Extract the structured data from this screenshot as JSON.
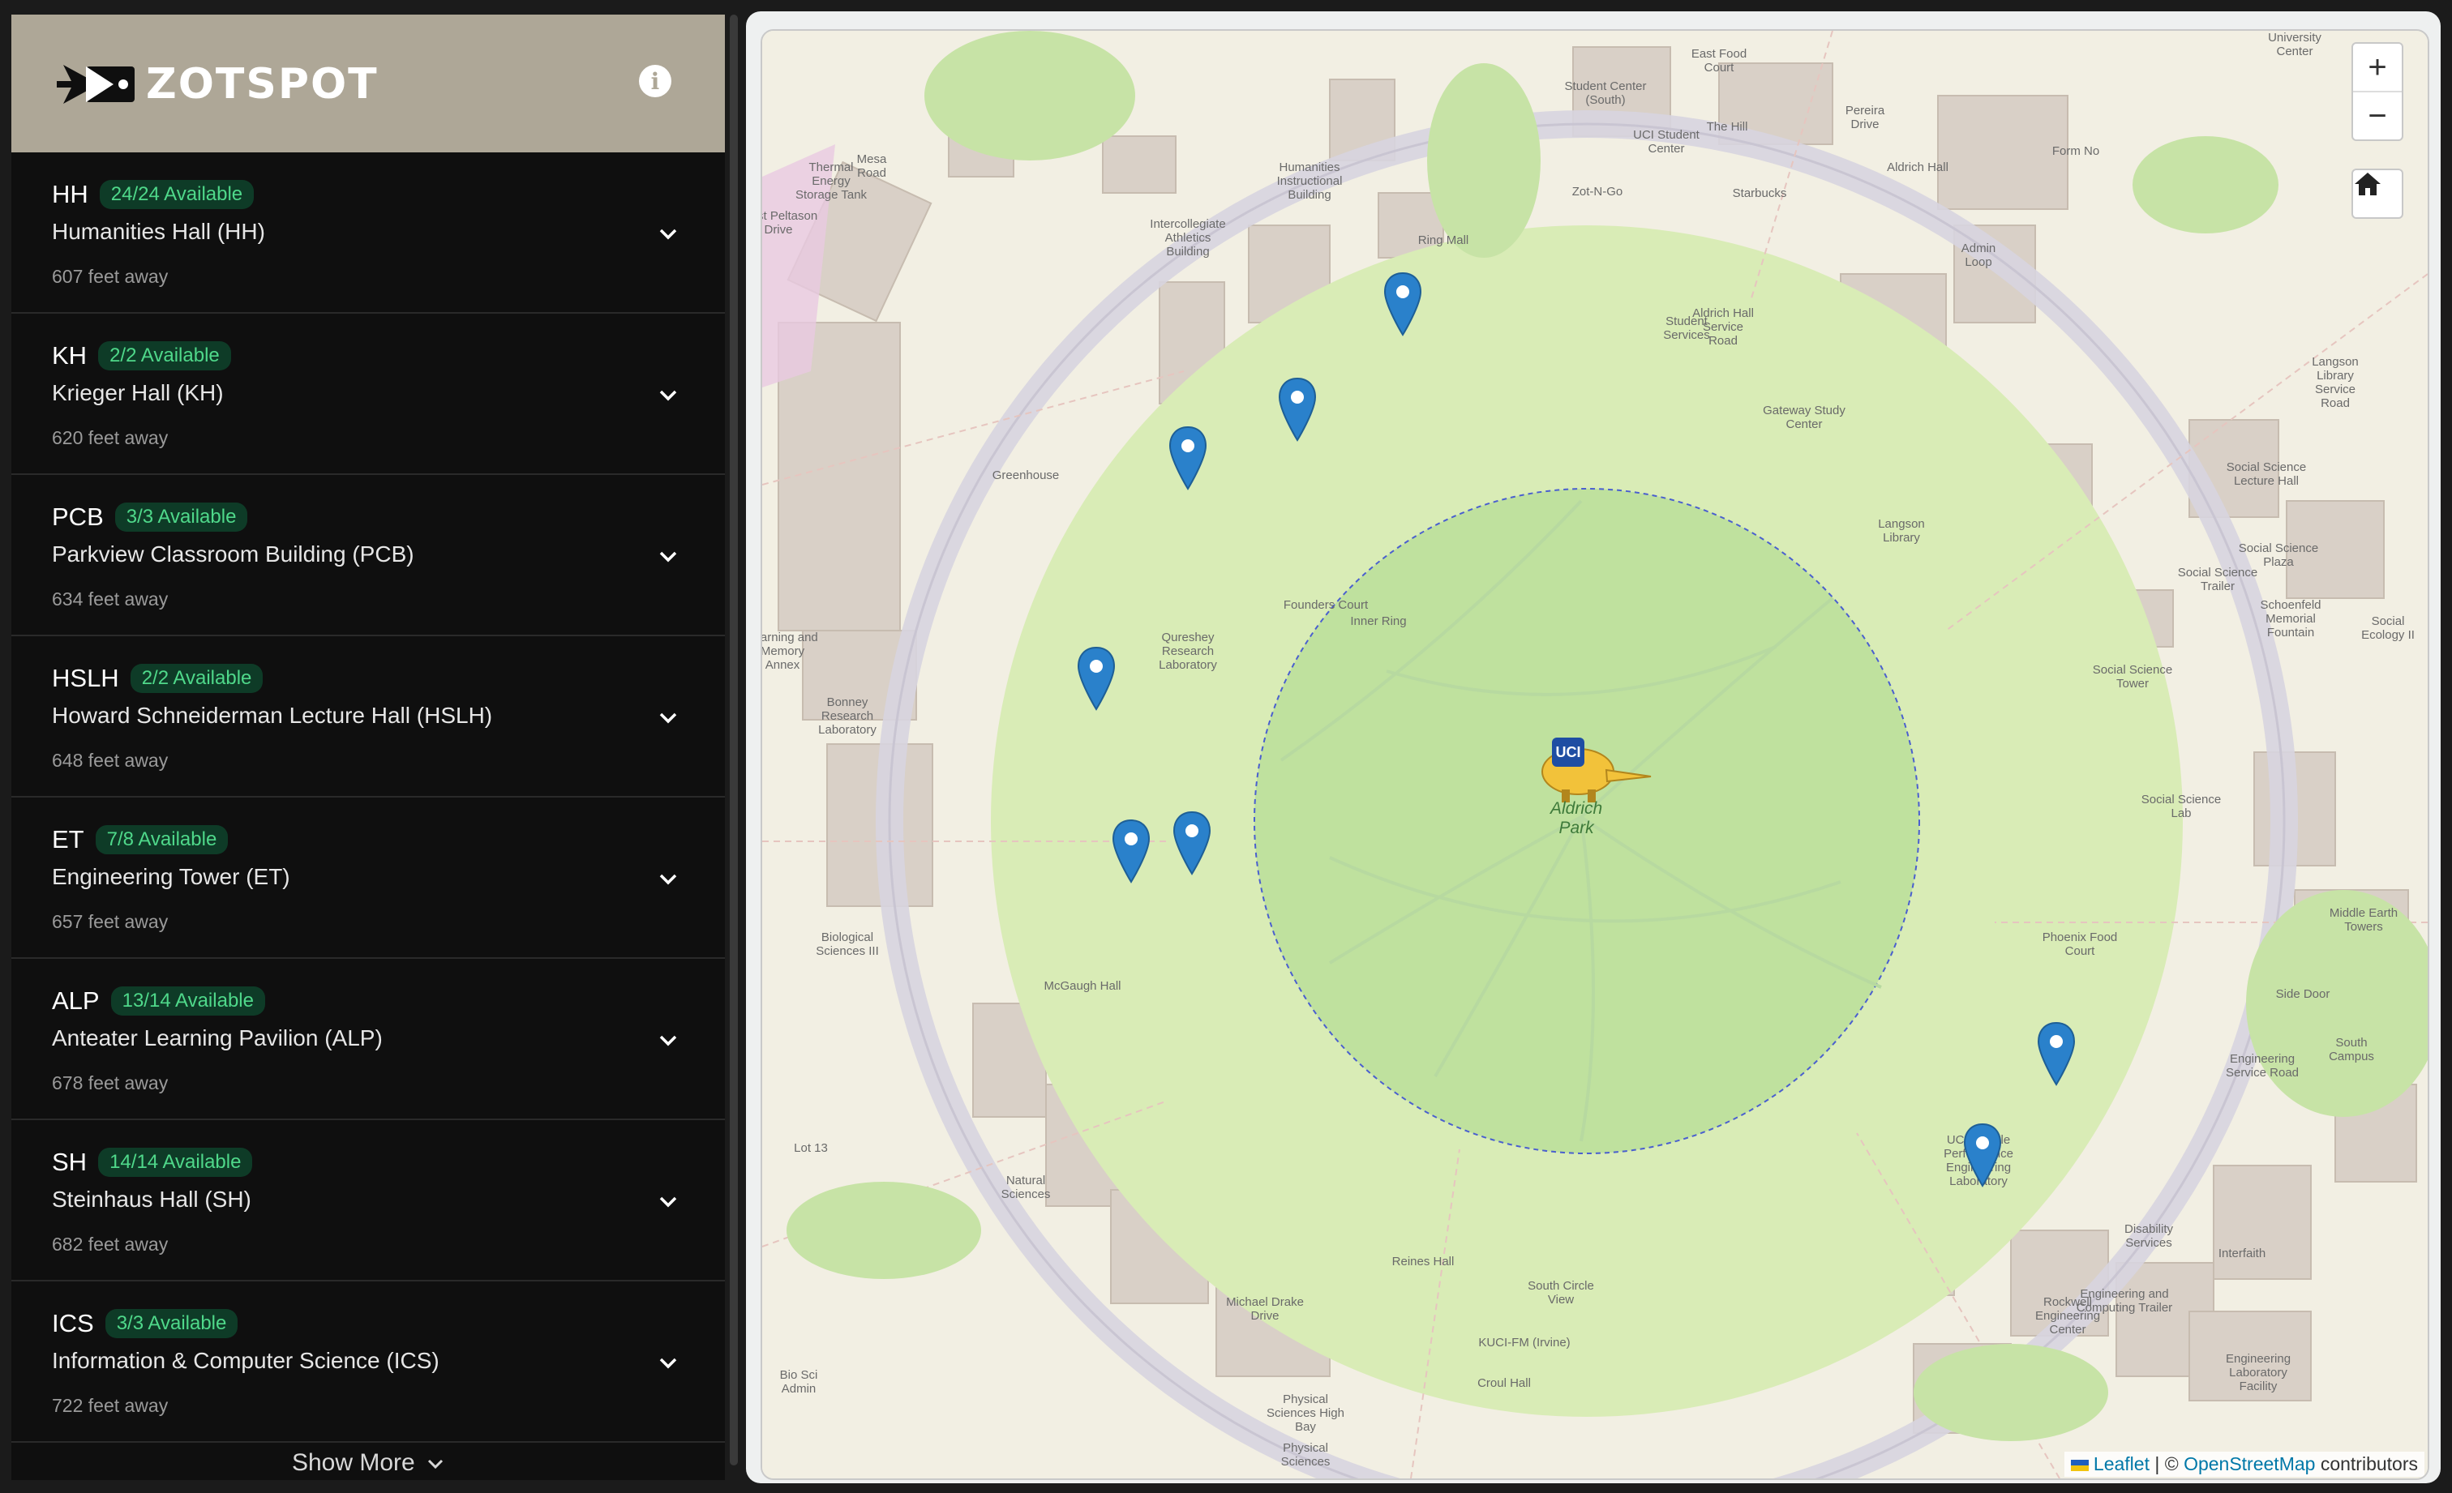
{
  "app": {
    "title": "ZOTSPOT"
  },
  "buildings": [
    {
      "code": "HH",
      "badge": "24/24 Available",
      "name": "Humanities Hall (HH)",
      "distance": "607 feet away"
    },
    {
      "code": "KH",
      "badge": "2/2 Available",
      "name": "Krieger Hall (KH)",
      "distance": "620 feet away"
    },
    {
      "code": "PCB",
      "badge": "3/3 Available",
      "name": "Parkview Classroom Building (PCB)",
      "distance": "634 feet away"
    },
    {
      "code": "HSLH",
      "badge": "2/2 Available",
      "name": "Howard Schneiderman Lecture Hall (HSLH)",
      "distance": "648 feet away"
    },
    {
      "code": "ET",
      "badge": "7/8 Available",
      "name": "Engineering Tower (ET)",
      "distance": "657 feet away"
    },
    {
      "code": "ALP",
      "badge": "13/14 Available",
      "name": "Anteater Learning Pavilion (ALP)",
      "distance": "678 feet away"
    },
    {
      "code": "SH",
      "badge": "14/14 Available",
      "name": "Steinhaus Hall (SH)",
      "distance": "682 feet away"
    },
    {
      "code": "ICS",
      "badge": "3/3 Available",
      "name": "Information & Computer Science (ICS)",
      "distance": "722 feet away"
    }
  ],
  "show_more": "Show More",
  "map": {
    "zoom_in": "+",
    "zoom_out": "−",
    "attribution": {
      "leaflet": "Leaflet",
      "sep": "| ©",
      "osm": "OpenStreetMap",
      "contributors": "contributors"
    },
    "park_label_1": "Aldrich",
    "park_label_2": "Park",
    "labels": [
      "Student Center (South)",
      "UCI Student Center",
      "Humanities Instructional Building",
      "Intercollegiate Athletics Building",
      "Thermal Energy Storage Tank",
      "Greenhouse",
      "Founders Court",
      "Qureshey Research Laboratory",
      "Bonney Research Laboratory",
      "Biological Sciences III",
      "McGaugh Hall",
      "Natural Sciences",
      "Reines Hall",
      "Croul Hall",
      "Physical Sciences High Bay",
      "Physical Sciences",
      "Langson Library",
      "Gateway Study Center",
      "Student Services",
      "Aldrich Hall",
      "Social Science Lecture Hall",
      "Social Science Plaza",
      "Social Science Tower",
      "Social Science Lab",
      "Social Ecology II",
      "Middle Earth Towers",
      "Phoenix Food Court",
      "Engineering Laboratory Facility",
      "Engineering and Computing Trailer",
      "Rockwell Engineering Center",
      "Disability Services",
      "Interfaith",
      "KUCI-FM (Irvine)",
      "Starbucks",
      "Zot-N-Go",
      "The Hill",
      "Form No",
      "Side Door",
      "South Campus",
      "Inner Ring",
      "Ring Mall",
      "Mesa Road",
      "West Peltason Drive",
      "Pereira Drive",
      "Engineering Service Road",
      "Langson Library Service Road",
      "Michael Drake Drive",
      "South Circle View",
      "Aldrich Hall Service Road"
    ],
    "label_extra": [
      "Learning and Memory Annex",
      "Bio Sci Admin",
      "Social Science Trailer",
      "Schoenfeld Memorial Fountain",
      "UCI Vehicle Performance Engineering Laboratory",
      "University Center",
      "East Food Court",
      "Lot 13",
      "Admin Loop"
    ]
  }
}
